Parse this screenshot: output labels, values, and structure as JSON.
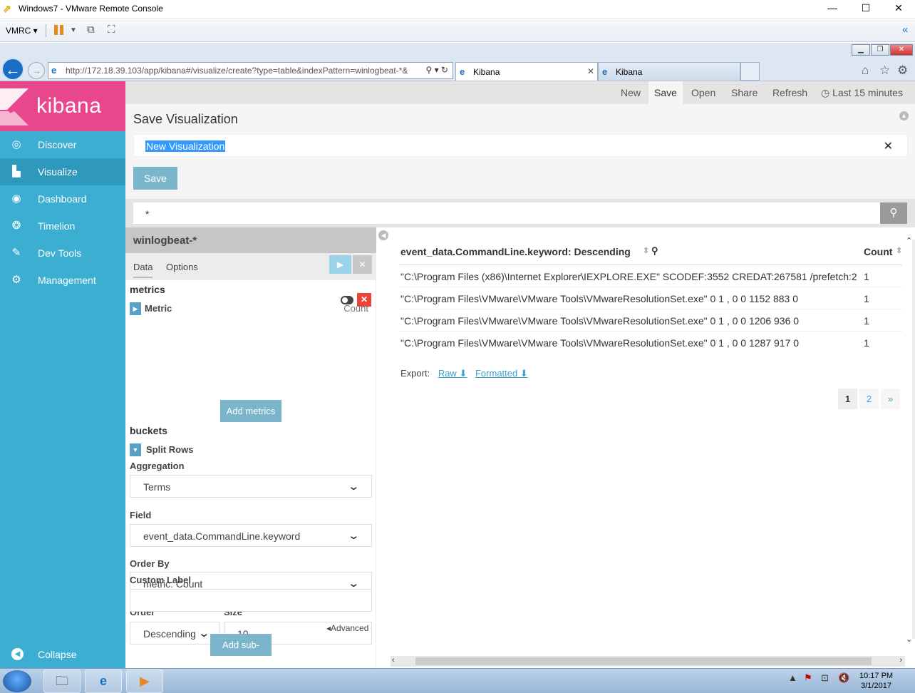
{
  "window": {
    "title": "Windows7 - VMware Remote Console"
  },
  "vmrc_toolbar": {
    "menu_label": "VMRC ▾"
  },
  "browser": {
    "url_host": "http://172.18.39.103",
    "url_path": "/app/kibana#/visualize/create?type=table&indexPattern=winlogbeat-*&",
    "tabs": [
      {
        "label": "Kibana",
        "active": true
      },
      {
        "label": "Kibana",
        "active": false
      }
    ]
  },
  "kibana": {
    "brand": "kibana",
    "nav": [
      {
        "label": "Discover",
        "icon": "compass-icon"
      },
      {
        "label": "Visualize",
        "icon": "bar-chart-icon",
        "active": true
      },
      {
        "label": "Dashboard",
        "icon": "dashboard-icon"
      },
      {
        "label": "Timelion",
        "icon": "timelion-icon"
      },
      {
        "label": "Dev Tools",
        "icon": "wrench-icon"
      },
      {
        "label": "Management",
        "icon": "gear-icon"
      }
    ],
    "collapse_label": "Collapse",
    "topnav": {
      "new": "New",
      "save": "Save",
      "open": "Open",
      "share": "Share",
      "refresh": "Refresh",
      "time": "Last 15 minutes"
    },
    "save_panel": {
      "title": "Save Visualization",
      "name_value": "New Visualization",
      "save_button": "Save"
    },
    "query": {
      "value": "*"
    },
    "editor": {
      "index_pattern": "winlogbeat-*",
      "tabs": [
        "Data",
        "Options"
      ],
      "metrics_title": "metrics",
      "metric_label": "Metric",
      "metric_value": "Count",
      "add_metrics": "Add metrics",
      "buckets_title": "buckets",
      "split_rows": "Split Rows",
      "aggregation_label": "Aggregation",
      "aggregation_value": "Terms",
      "field_label": "Field",
      "field_value": "event_data.CommandLine.keyword",
      "order_by_label": "Order By",
      "order_by_value": "metric: Count",
      "order_label": "Order",
      "order_value": "Descending",
      "size_label": "Size",
      "size_value": "10",
      "custom_label": "Custom Label",
      "custom_value": "",
      "advanced": "Advanced",
      "add_sub_buckets": "Add sub-buckets"
    },
    "results": {
      "col_term": "event_data.CommandLine.keyword: Descending",
      "col_count": "Count",
      "rows": [
        {
          "cmd": "\"C:\\Program Files (x86)\\Internet Explorer\\IEXPLORE.EXE\" SCODEF:3552 CREDAT:267581 /prefetch:2",
          "count": "1"
        },
        {
          "cmd": "\"C:\\Program Files\\VMware\\VMware Tools\\VMwareResolutionSet.exe\" 0 1 , 0 0 1152 883 0",
          "count": "1"
        },
        {
          "cmd": "\"C:\\Program Files\\VMware\\VMware Tools\\VMwareResolutionSet.exe\" 0 1 , 0 0 1206 936 0",
          "count": "1"
        },
        {
          "cmd": "\"C:\\Program Files\\VMware\\VMware Tools\\VMwareResolutionSet.exe\" 0 1 , 0 0 1287 917 0",
          "count": "1"
        }
      ],
      "export_label": "Export:",
      "export_raw": "Raw",
      "export_formatted": "Formatted",
      "pages": [
        "1",
        "2",
        "»"
      ]
    }
  },
  "taskbar": {
    "time": "10:17 PM",
    "date": "3/1/2017"
  },
  "colors": {
    "kibana_pink": "#e8488b",
    "sidebar_blue": "#3caed2",
    "button_blue": "#7bb5cb"
  }
}
